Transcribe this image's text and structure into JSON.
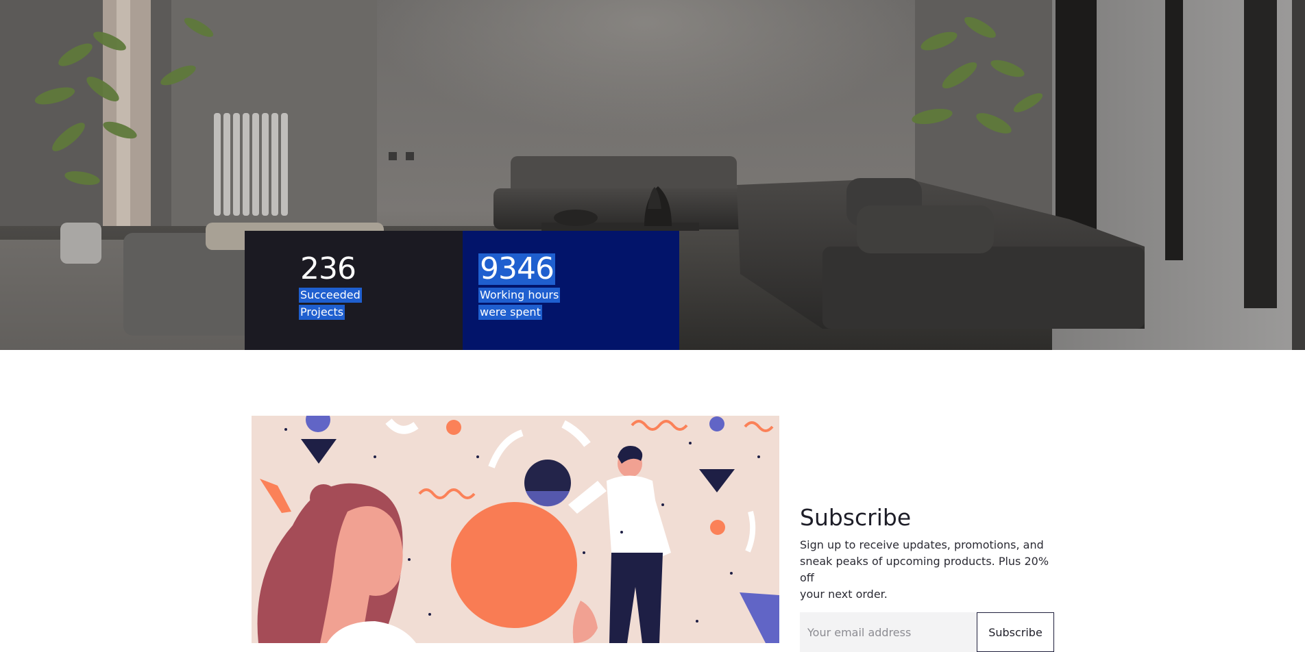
{
  "hero": {
    "stats": [
      {
        "number": "236",
        "label_lines": [
          "Succeeded",
          "Projects"
        ]
      },
      {
        "number": "9346",
        "label_lines": [
          "Working hours",
          "were spent"
        ]
      }
    ]
  },
  "subscribe": {
    "title": "Subscribe",
    "description_lines": [
      "Sign up to receive updates, promotions, and",
      "sneak peaks of upcoming products. Plus 20% off",
      "your next order."
    ],
    "email_placeholder": "Your email address",
    "button_label": "Subscribe"
  },
  "colors": {
    "stat_dark_bg": "#1b1a22",
    "stat_blue_bg": "#02146a",
    "selection_highlight": "#1f5fcf",
    "illustration_bg": "#f1ddd4",
    "accent_orange": "#fb8158",
    "accent_violet": "#6165c6",
    "navy": "#1e1f45"
  }
}
